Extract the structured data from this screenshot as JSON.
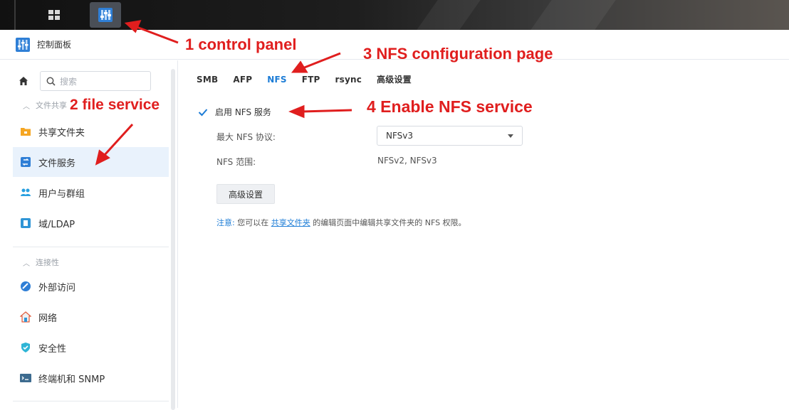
{
  "colors": {
    "accent": "#1c7cd6",
    "annotation": "#e01e1e",
    "active_bg": "#e9f2fc"
  },
  "app": {
    "title": "控制面板"
  },
  "search": {
    "placeholder": "搜索"
  },
  "sidebar": {
    "sections": [
      {
        "label": "文件共享"
      },
      {
        "label": "连接性"
      }
    ],
    "items": [
      {
        "label": "共享文件夹",
        "icon": "folder-icon"
      },
      {
        "label": "文件服务",
        "icon": "file-services-icon",
        "active": true
      },
      {
        "label": "用户与群组",
        "icon": "users-icon"
      },
      {
        "label": "域/LDAP",
        "icon": "domain-icon"
      },
      {
        "label": "外部访问",
        "icon": "external-access-icon"
      },
      {
        "label": "网络",
        "icon": "network-icon"
      },
      {
        "label": "安全性",
        "icon": "shield-icon"
      },
      {
        "label": "终端机和 SNMP",
        "icon": "terminal-icon"
      }
    ]
  },
  "tabs": [
    {
      "label": "SMB"
    },
    {
      "label": "AFP"
    },
    {
      "label": "NFS",
      "active": true
    },
    {
      "label": "FTP"
    },
    {
      "label": "rsync"
    },
    {
      "label": "高级设置"
    }
  ],
  "nfs": {
    "enable_label": "启用 NFS 服务",
    "enabled": true,
    "max_protocol_label": "最大 NFS 协议:",
    "max_protocol_value": "NFSv3",
    "range_label": "NFS 范围:",
    "range_value": "NFSv2, NFSv3",
    "advanced_button": "高级设置",
    "note_prefix": "注意:",
    "note_text_1": "您可以在",
    "note_link": "共享文件夹",
    "note_text_2": "的编辑页面中编辑共享文件夹的 NFS 权限。"
  },
  "annotations": {
    "a1": "1 control panel",
    "a2": "2 file service",
    "a3": "3 NFS configuration page",
    "a4": "4 Enable NFS service"
  }
}
